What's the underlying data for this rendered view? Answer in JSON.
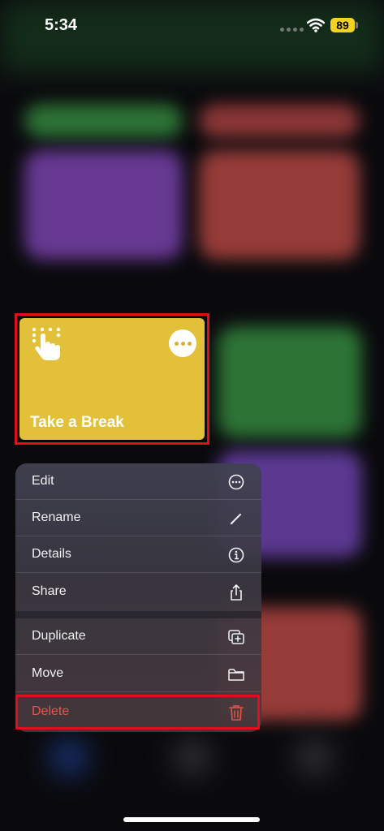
{
  "status_bar": {
    "time": "5:34",
    "battery": "89"
  },
  "shortcut_card": {
    "title": "Take a Break",
    "color": "#e2c03a"
  },
  "context_menu": {
    "items": [
      {
        "label": "Edit",
        "icon": "ellipsis-circle-icon"
      },
      {
        "label": "Rename",
        "icon": "pencil-icon"
      },
      {
        "label": "Details",
        "icon": "info-circle-icon"
      },
      {
        "label": "Share",
        "icon": "share-icon"
      },
      {
        "label": "Duplicate",
        "icon": "duplicate-icon"
      },
      {
        "label": "Move",
        "icon": "folder-icon"
      },
      {
        "label": "Delete",
        "icon": "trash-icon",
        "color": "#e7554a"
      }
    ]
  },
  "highlight_color": "#e0101a"
}
